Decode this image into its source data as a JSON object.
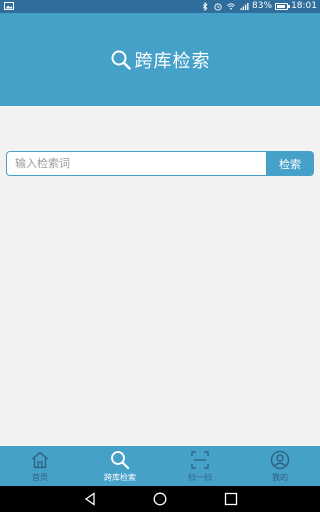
{
  "status_bar": {
    "battery_percent_label": "83%",
    "time": "18:01",
    "battery_level": 0.83
  },
  "header": {
    "title": "跨库检索",
    "icon": "search-icon"
  },
  "search": {
    "placeholder": "输入检索词",
    "value": "",
    "button_label": "检索"
  },
  "tabs": [
    {
      "label": "首页",
      "icon": "home-icon",
      "active": false
    },
    {
      "label": "跨库检索",
      "icon": "search-icon",
      "active": true
    },
    {
      "label": "扫一扫",
      "icon": "scan-icon",
      "active": false
    },
    {
      "label": "我的",
      "icon": "user-icon",
      "active": false
    }
  ],
  "nav": {
    "back": "back-icon",
    "home": "home-circle-icon",
    "recents": "recents-icon"
  },
  "colors": {
    "primary": "#46a1c8",
    "status_bar": "#2f6e9c",
    "inactive_tab_label": "#2c5f7c",
    "background": "#f2f2f2"
  }
}
